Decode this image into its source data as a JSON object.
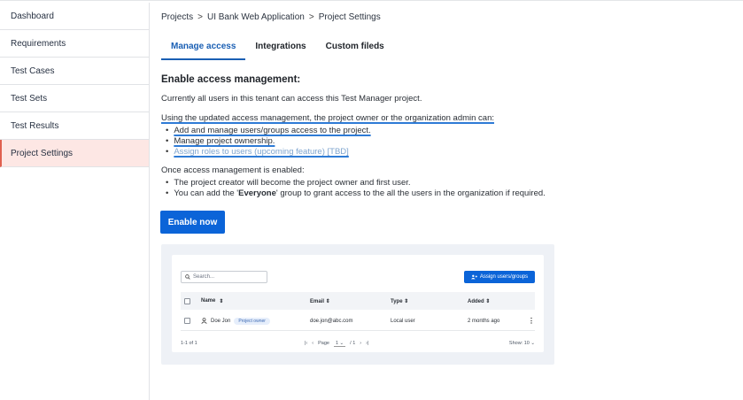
{
  "sidebar": {
    "items": [
      {
        "label": "Dashboard"
      },
      {
        "label": "Requirements"
      },
      {
        "label": "Test Cases"
      },
      {
        "label": "Test Sets"
      },
      {
        "label": "Test Results"
      },
      {
        "label": "Project Settings"
      }
    ],
    "active_index": 5,
    "accent_color": "#e0604f"
  },
  "breadcrumb": {
    "items": [
      "Projects",
      "UI Bank Web Application",
      "Project Settings"
    ],
    "separator": ">"
  },
  "tabs": [
    {
      "label": "Manage access",
      "active": true
    },
    {
      "label": "Integrations",
      "active": false
    },
    {
      "label": "Custom fileds",
      "active": false
    }
  ],
  "content": {
    "title": "Enable access management:",
    "intro": "Currently all users in this tenant can access this Test Manager project.",
    "updated_heading": "Using the updated access management, the project owner or the organization admin can:",
    "capabilities": [
      "Add and manage users/groups access to the project.",
      "Manage project ownership.",
      "Assign roles to users (upcoming feature) [TBD]"
    ],
    "once_heading": "Once access management is enabled:",
    "once_items": [
      {
        "text": "The project creator will become the project owner and first user."
      },
      {
        "pre": "You can add the '",
        "bold": "Everyone",
        "post": "' group to grant access to the all the users in the organization if required."
      }
    ],
    "enable_button": "Enable now",
    "primary_color": "#0b64d8"
  },
  "preview": {
    "search_placeholder": "Search...",
    "assign_button": "Assign users/groups",
    "columns": [
      "Name",
      "Email",
      "Type",
      "Added"
    ],
    "sort_glyph": "⇕",
    "rows": [
      {
        "name": "Doe Jon",
        "badge": "Project owner",
        "email": "doe.jon@abc.com",
        "type": "Local user",
        "added": "2 months ago"
      }
    ],
    "footer": {
      "count": "1-1 of 1",
      "page_label": "Page",
      "page_value": "1",
      "page_total": "/ 1",
      "show": "Show: 10"
    }
  }
}
